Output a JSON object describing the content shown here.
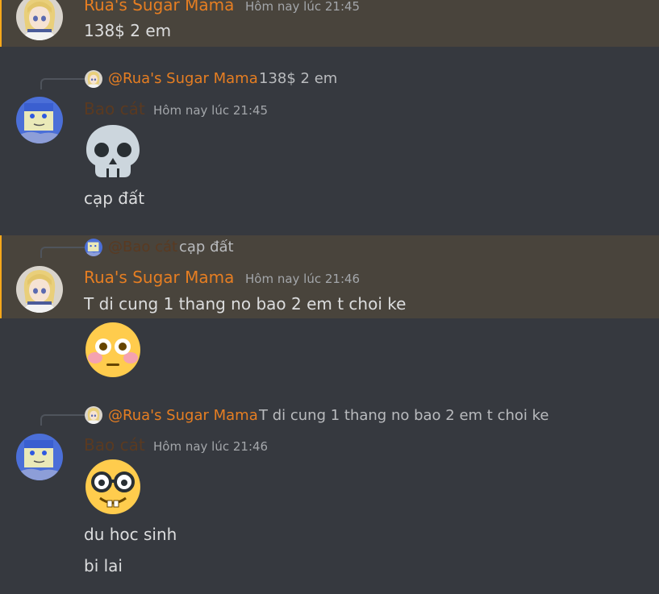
{
  "colors": {
    "background": "#36393f",
    "mention_highlight": "#49443c",
    "mention_bar": "#faa81a",
    "rua_name": "#e67e22",
    "bao_name": "#5a3a21",
    "timestamp": "#a3a6aa"
  },
  "messages": [
    {
      "author": "Rua's Sugar Mama",
      "timestamp": "Hôm nay lúc 21:45",
      "lines": [
        "138$ 2 em"
      ],
      "highlighted": true
    },
    {
      "reply": {
        "mention": "@Rua's Sugar Mama",
        "text": "138$ 2 em",
        "avatar_icon": "anime-girl-avatar-icon"
      },
      "author": "Bao cát",
      "timestamp": "Hôm nay lúc 21:45",
      "emoji_icon": "skull-emoji",
      "lines": [
        "cạp đất"
      ]
    },
    {
      "reply": {
        "mention": "@Bao cát",
        "text": "cạp đất",
        "avatar_icon": "blue-face-avatar-icon"
      },
      "author": "Rua's Sugar Mama",
      "timestamp": "Hôm nay lúc 21:46",
      "lines": [
        "T di cung 1 thang no bao 2 em t choi ke"
      ],
      "emoji_icon": "flushed-face-emoji",
      "highlighted": true
    },
    {
      "reply": {
        "mention": "@Rua's Sugar Mama",
        "text": "T di cung 1 thang no bao 2 em t choi ke",
        "avatar_icon": "anime-girl-avatar-icon"
      },
      "author": "Bao cát",
      "timestamp": "Hôm nay lúc 21:46",
      "emoji_icon": "nerd-face-emoji",
      "lines": [
        "du hoc sinh",
        "bi lai"
      ]
    }
  ]
}
